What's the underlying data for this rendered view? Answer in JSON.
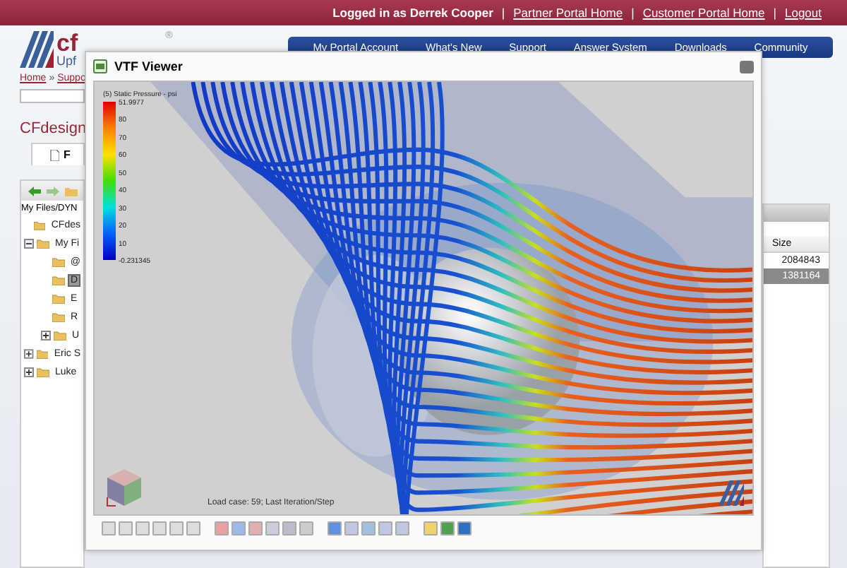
{
  "top_bar": {
    "user": "Logged in as Derrek Cooper",
    "separator": "|",
    "links": [
      "Partner Portal Home",
      "Customer Portal Home",
      "Logout"
    ]
  },
  "logo": {
    "mark": "cf",
    "tagline": "Upf",
    "registered": "®"
  },
  "nav": [
    "My Portal Account",
    "What's New",
    "Support",
    "Answer System",
    "Downloads",
    "Community"
  ],
  "breadcrumb": [
    {
      "label": "Home",
      "link": true
    },
    {
      "label": "»",
      "link": false
    },
    {
      "label": "Suppo",
      "link": true
    }
  ],
  "heading": "CFdesign",
  "tab": {
    "label": "F",
    "selected": true
  },
  "path": "My Files/DYN",
  "tree": [
    {
      "label": "CFdes",
      "expandable": false,
      "selected": false
    },
    {
      "label": "My Fi",
      "expandable": true,
      "expanded": true,
      "selected": false,
      "children": [
        {
          "label": "@",
          "expandable": false,
          "selected": false
        },
        {
          "label": "D",
          "expandable": false,
          "selected": true
        },
        {
          "label": "E",
          "expandable": false,
          "selected": false
        },
        {
          "label": "R",
          "expandable": false,
          "selected": false
        },
        {
          "label": "U",
          "expandable": true,
          "expanded": false,
          "selected": false
        }
      ]
    },
    {
      "label": "Eric S",
      "expandable": true,
      "expanded": false,
      "selected": false
    },
    {
      "label": "Luke",
      "expandable": true,
      "expanded": false,
      "selected": false
    }
  ],
  "file_table": {
    "columns": [
      "Size"
    ],
    "rows": [
      {
        "size": "2084843",
        "selected": false
      },
      {
        "size": "1381164",
        "selected": true
      }
    ]
  },
  "viewer": {
    "title": "VTF Viewer",
    "legend": {
      "title": "(5) Static Pressure - psi",
      "max": "51.9977",
      "ticks": [
        "80",
        "70",
        "60",
        "50",
        "40",
        "30",
        "20",
        "10"
      ],
      "min": "-0.231345"
    },
    "status": "Load case: 59; Last Iteration/Step"
  }
}
